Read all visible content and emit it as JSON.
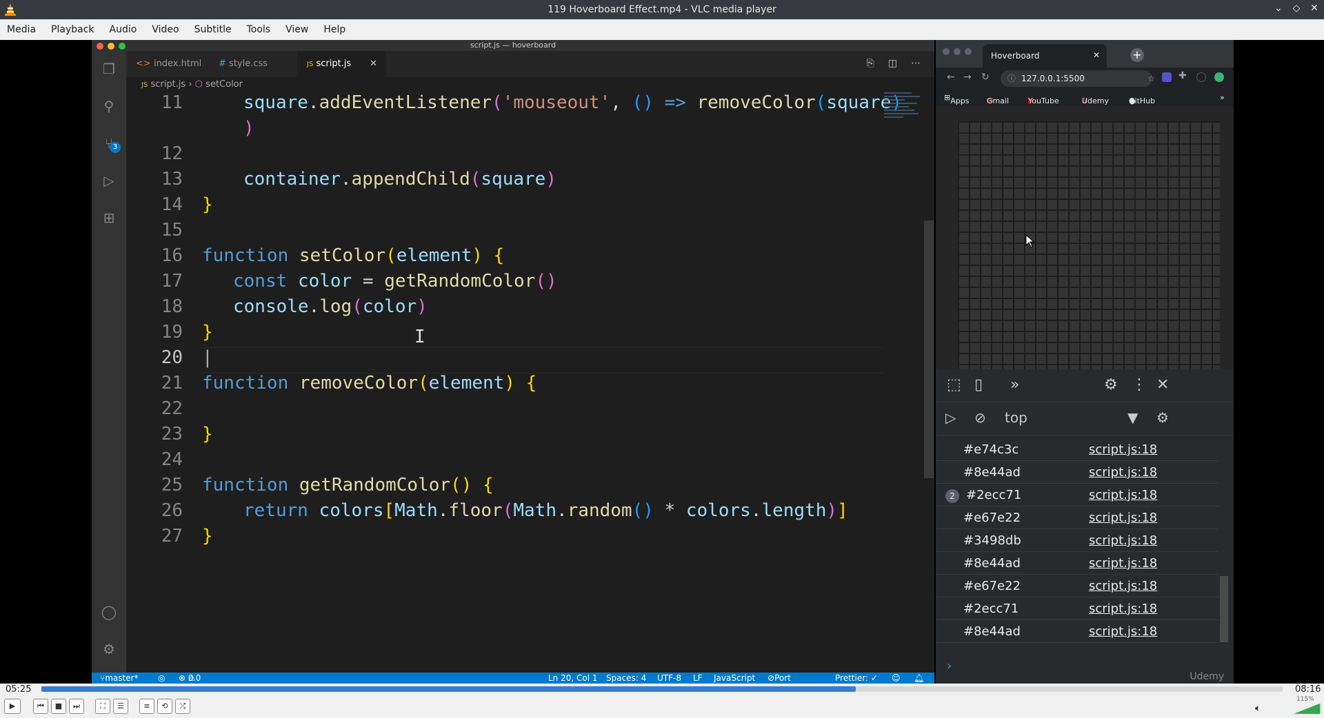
{
  "vlc": {
    "window_title": "119 Hoverboard Effect.mp4 - VLC media player",
    "menu": [
      "Media",
      "Playback",
      "Audio",
      "Video",
      "Subtitle",
      "Tools",
      "View",
      "Help"
    ],
    "time_elapsed": "05:25",
    "time_total": "08:16",
    "progress": 0.656,
    "volume_label": "115%"
  },
  "vscode": {
    "window_title": "script.js — hoverboard",
    "tabs": [
      {
        "icon": "<>",
        "label": "index.html",
        "active": false
      },
      {
        "icon": "#",
        "label": "style.css",
        "active": false
      },
      {
        "icon": "JS",
        "label": "script.js",
        "active": true
      }
    ],
    "breadcrumb": {
      "file": "script.js",
      "symbol": "setColor"
    },
    "scm_badge": "3",
    "line_numbers": [
      "11",
      "",
      "12",
      "13",
      "14",
      "15",
      "16",
      "17",
      "18",
      "19",
      "20",
      "21",
      "22",
      "23",
      "24",
      "25",
      "26",
      "27"
    ],
    "status": {
      "branch": "master*",
      "problems": "0",
      "warnings": "0",
      "position": "Ln 20, Col 1",
      "spaces": "Spaces: 4",
      "encoding": "UTF-8",
      "eol": "LF",
      "language": "JavaScript",
      "port": "Port : 5500",
      "prettier": "Prettier: ✓"
    }
  },
  "browser": {
    "tab_title": "Hoverboard",
    "url": "127.0.0.1:5500",
    "bookmarks": [
      "Apps",
      "Gmail",
      "YouTube",
      "Udemy",
      "GitHub"
    ],
    "devtools": {
      "context": "top",
      "rows": [
        {
          "value": "#e74c3c",
          "source": "script.js:18",
          "count": ""
        },
        {
          "value": "#8e44ad",
          "source": "script.js:18",
          "count": ""
        },
        {
          "value": "#2ecc71",
          "source": "script.js:18",
          "count": "2"
        },
        {
          "value": "#e67e22",
          "source": "script.js:18",
          "count": ""
        },
        {
          "value": "#3498db",
          "source": "script.js:18",
          "count": ""
        },
        {
          "value": "#8e44ad",
          "source": "script.js:18",
          "count": ""
        },
        {
          "value": "#e67e22",
          "source": "script.js:18",
          "count": ""
        },
        {
          "value": "#2ecc71",
          "source": "script.js:18",
          "count": ""
        },
        {
          "value": "#8e44ad",
          "source": "script.js:18",
          "count": ""
        }
      ],
      "prompt": "›"
    },
    "watermark": "Udemy"
  }
}
